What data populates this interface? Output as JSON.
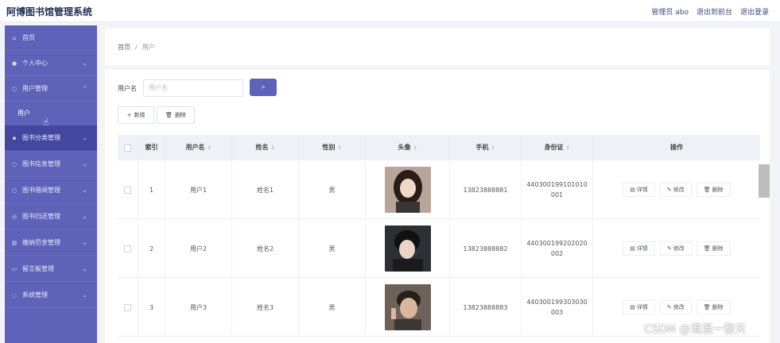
{
  "app": {
    "title": "阿博图书馆管理系统",
    "top_links": [
      "管理员 abo",
      "退出到前台",
      "退出登录"
    ]
  },
  "sidebar": {
    "items": [
      {
        "label": "首页",
        "icon": "home-icon",
        "chevron": false
      },
      {
        "label": "个人中心",
        "icon": "user-icon",
        "chevron": true
      },
      {
        "label": "用户管理",
        "icon": "users-icon",
        "chevron": true,
        "expanded": true
      },
      {
        "label": "图书分类管理",
        "icon": "book-icon",
        "chevron": true,
        "active": true
      },
      {
        "label": "图书信息管理",
        "icon": "info-icon",
        "chevron": true
      },
      {
        "label": "图书借阅管理",
        "icon": "borrow-icon",
        "chevron": true
      },
      {
        "label": "图书归还管理",
        "icon": "return-icon",
        "chevron": true
      },
      {
        "label": "缴纳罚金管理",
        "icon": "money-icon",
        "chevron": true
      },
      {
        "label": "留言板管理",
        "icon": "message-icon",
        "chevron": true
      },
      {
        "label": "系统管理",
        "icon": "settings-icon",
        "chevron": true
      }
    ],
    "submenu": {
      "label": "用户"
    }
  },
  "breadcrumb": {
    "home": "首页",
    "separator": "/",
    "current": "用户"
  },
  "search": {
    "label": "用户名",
    "placeholder": "用户名",
    "button_icon": "search-icon"
  },
  "toolbar": {
    "add_label": "新增",
    "delete_label": "删除"
  },
  "table": {
    "headers": [
      "索引",
      "用户名",
      "姓名",
      "性别",
      "头像",
      "手机",
      "身份证",
      "操作"
    ],
    "rows": [
      {
        "index": "1",
        "username": "用户1",
        "name": "姓名1",
        "gender": "男",
        "phone": "13823888881",
        "idcard": "440300199101010001"
      },
      {
        "index": "2",
        "username": "用户2",
        "name": "姓名2",
        "gender": "男",
        "phone": "13823888882",
        "idcard": "440300199202020002"
      },
      {
        "index": "3",
        "username": "用户3",
        "name": "姓名3",
        "gender": "男",
        "phone": "13823888883",
        "idcard": "440300199303030003"
      }
    ],
    "actions": {
      "detail": "详情",
      "edit": "修改",
      "delete": "删除"
    }
  },
  "watermark": "CSDN @混混一整天",
  "colors": {
    "sidebar": "#5e62b8",
    "sidebar_active": "#4347a0",
    "accent": "#5e62b8"
  }
}
